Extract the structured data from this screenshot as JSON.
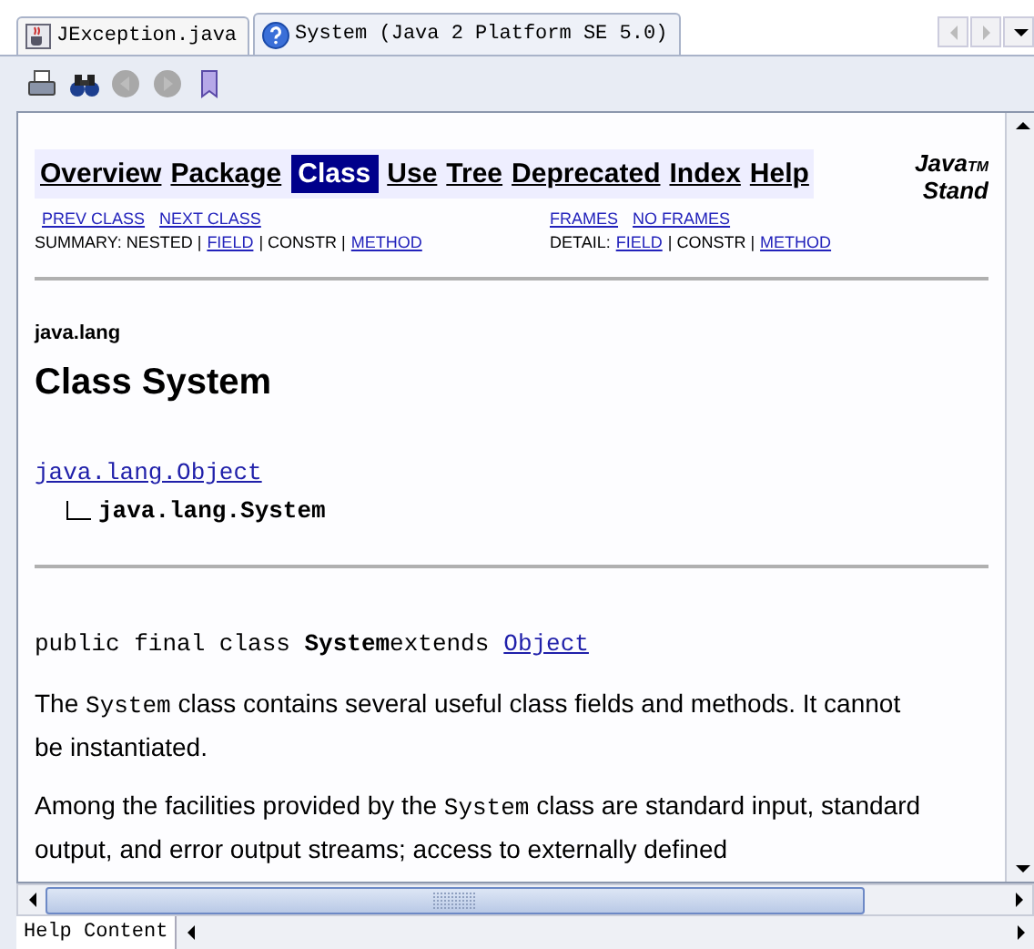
{
  "tabs": [
    {
      "label": "JException.java",
      "selected": false
    },
    {
      "label": "System (Java 2 Platform SE 5.0)",
      "selected": true
    }
  ],
  "toolbar": [
    {
      "kind": "print",
      "disabled": false
    },
    {
      "kind": "find",
      "disabled": false
    },
    {
      "kind": "back",
      "disabled": true
    },
    {
      "kind": "forward",
      "disabled": true
    },
    {
      "kind": "bookmark",
      "disabled": false
    }
  ],
  "nav": [
    {
      "label": "Overview",
      "selected": false
    },
    {
      "label": "Package",
      "selected": false
    },
    {
      "label": "Class",
      "selected": true
    },
    {
      "label": "Use",
      "selected": false
    },
    {
      "label": "Tree",
      "selected": false
    },
    {
      "label": "Deprecated",
      "selected": false
    },
    {
      "label": "Index",
      "selected": false
    },
    {
      "label": "Help",
      "selected": false
    }
  ],
  "header_title": {
    "main": "Java",
    "mark": "TM",
    "second": "Stand"
  },
  "subnav_left": [
    "PREV CLASS",
    "NEXT CLASS"
  ],
  "subnav_right": [
    "FRAMES",
    "NO FRAMES"
  ],
  "summary": [
    {
      "kind": "text",
      "text": "SUMMARY: NESTED |"
    },
    {
      "kind": "link",
      "text": "FIELD"
    },
    {
      "kind": "text",
      "text": "| CONSTR |"
    },
    {
      "kind": "link",
      "text": "METHOD"
    }
  ],
  "detail": [
    {
      "kind": "text",
      "text": "DETAIL:"
    },
    {
      "kind": "link",
      "text": "FIELD"
    },
    {
      "kind": "text",
      "text": "| CONSTR |"
    },
    {
      "kind": "link",
      "text": "METHOD"
    }
  ],
  "package": "java.lang",
  "class_title": "Class System",
  "hierarchy": {
    "parent": "java.lang.Object",
    "child": "java.lang.System"
  },
  "declaration": {
    "text": "public final class **System**extends",
    "link": "Object"
  },
  "paragraphs": [
    [
      {
        "kind": "text",
        "text": "The "
      },
      {
        "kind": "code",
        "text": "System"
      },
      {
        "kind": "text",
        "text": " class contains several useful class fields and methods. It cannot be instantiated."
      }
    ],
    [
      {
        "kind": "text",
        "text": "Among the facilities provided by the "
      },
      {
        "kind": "code",
        "text": "System"
      },
      {
        "kind": "text",
        "text": " class are standard input, standard output, and error output streams; access to externally defined"
      }
    ]
  ],
  "bottom_tab": "Help Content"
}
